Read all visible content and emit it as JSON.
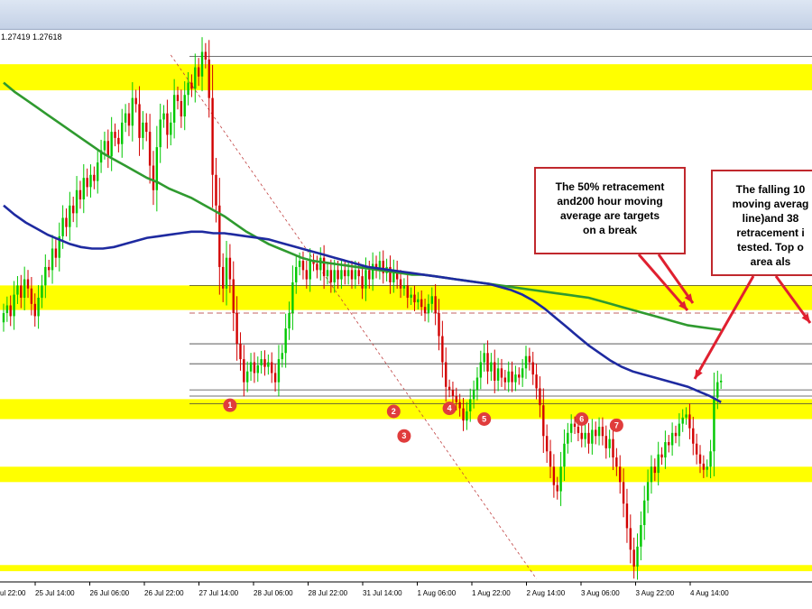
{
  "window": {
    "ohlc_text": "1.27419 1.27618"
  },
  "colors": {
    "background": "#ffffff",
    "zone": "#ffff00",
    "bull_candle": "#00c800",
    "bear_candle": "#d20000",
    "ma_100": "#1e2aa0",
    "ma_200": "#2f9a2f",
    "marker": "#e03c3c",
    "callout_border": "#c0282d",
    "arrow": "#e02030"
  },
  "chart_data": {
    "type": "candlestick",
    "x_tick_labels": [
      "25 Jul 14:00",
      "26 Jul 06:00",
      "26 Jul 22:00",
      "27 Jul 14:00",
      "28 Jul 06:00",
      "28 Jul 22:00",
      "31 Jul 14:00",
      "1 Aug 06:00",
      "1 Aug 22:00",
      "2 Aug 14:00",
      "3 Aug 06:00",
      "3 Aug 22:00",
      "4 Aug 14:00"
    ],
    "x_tick_partial": "ul 22:00",
    "ylim": [
      1.2615,
      1.2975
    ],
    "closes": [
      1.279,
      1.2795,
      1.2788,
      1.2802,
      1.2808,
      1.28,
      1.2812,
      1.2806,
      1.2796,
      1.2788,
      1.28,
      1.2808,
      1.282,
      1.2818,
      1.2832,
      1.2826,
      1.284,
      1.2852,
      1.2846,
      1.286,
      1.2855,
      1.287,
      1.2864,
      1.2878,
      1.2872,
      1.288,
      1.2876,
      1.2888,
      1.2896,
      1.2902,
      1.2892,
      1.2908,
      1.2904,
      1.29,
      1.2914,
      1.292,
      1.2912,
      1.293,
      1.2926,
      1.2904,
      1.2914,
      1.2908,
      1.2886,
      1.287,
      1.2898,
      1.2916,
      1.292,
      1.2906,
      1.2914,
      1.2932,
      1.2928,
      1.2918,
      1.2932,
      1.294,
      1.2936,
      1.295,
      1.2944,
      1.296,
      1.2955,
      1.293,
      1.288,
      1.286,
      1.282,
      1.2806,
      1.2826,
      1.2812,
      1.279,
      1.277,
      1.276,
      1.2745,
      1.2752,
      1.2758,
      1.2751,
      1.2756,
      1.276,
      1.2755,
      1.2758,
      1.2751,
      1.2745,
      1.276,
      1.2764,
      1.278,
      1.279,
      1.281,
      1.282,
      1.2824,
      1.2818,
      1.2812,
      1.2824,
      1.2822,
      1.2818,
      1.2826,
      1.2814,
      1.2818,
      1.281,
      1.2818,
      1.2812,
      1.2818,
      1.2814,
      1.2818,
      1.2812,
      1.2818,
      1.2814,
      1.2806,
      1.2818,
      1.2812,
      1.2822,
      1.2818,
      1.2824,
      1.2816,
      1.282,
      1.281,
      1.2818,
      1.2812,
      1.2806,
      1.2808,
      1.28,
      1.2802,
      1.2797,
      1.2799,
      1.2794,
      1.279,
      1.2796,
      1.2801,
      1.279,
      1.2775,
      1.2758,
      1.2742,
      1.274,
      1.2736,
      1.2732,
      1.2728,
      1.272,
      1.2726,
      1.2734,
      1.274,
      1.2748,
      1.2758,
      1.2764,
      1.2752,
      1.2758,
      1.2746,
      1.2754,
      1.2748,
      1.2745,
      1.2752,
      1.2745,
      1.275,
      1.2748,
      1.2754,
      1.2762,
      1.2758,
      1.275,
      1.2741,
      1.273,
      1.271,
      1.27,
      1.269,
      1.2678,
      1.2674,
      1.269,
      1.2705,
      1.2712,
      1.2718,
      1.2716,
      1.2712,
      1.2708,
      1.2712,
      1.2705,
      1.2714,
      1.271,
      1.2716,
      1.271,
      1.2702,
      1.2708,
      1.2696,
      1.269,
      1.268,
      1.2666,
      1.265,
      1.2636,
      1.2625,
      1.2638,
      1.2652,
      1.2668,
      1.268,
      1.269,
      1.2686,
      1.2698,
      1.2696,
      1.2706,
      1.2704,
      1.2712,
      1.271,
      1.2718,
      1.2722,
      1.2724,
      1.2715,
      1.2705,
      1.2698,
      1.2692,
      1.2688,
      1.269,
      1.27,
      1.2735,
      1.2745,
      1.2746
    ],
    "ma_100": [
      1.286,
      1.2854,
      1.2849,
      1.2845,
      1.2841,
      1.2838,
      1.2835,
      1.2833,
      1.2832,
      1.2832,
      1.2833,
      1.2835,
      1.2837,
      1.2839,
      1.284,
      1.2841,
      1.2842,
      1.2843,
      1.2843,
      1.2842,
      1.2842,
      1.2841,
      1.284,
      1.2839,
      1.2838,
      1.2836,
      1.2834,
      1.2832,
      1.283,
      1.2828,
      1.2826,
      1.2824,
      1.2822,
      1.282,
      1.2819,
      1.2818,
      1.2817,
      1.2816,
      1.2815,
      1.2814,
      1.2813,
      1.2812,
      1.2811,
      1.281,
      1.2809,
      1.2807,
      1.2805,
      1.2802,
      1.2798,
      1.2793,
      1.2787,
      1.2781,
      1.2775,
      1.2769,
      1.2764,
      1.2759,
      1.2755,
      1.2752,
      1.275,
      1.2748,
      1.2746,
      1.2744,
      1.2742,
      1.2739,
      1.2736,
      1.2732
    ],
    "ma_200": [
      1.294,
      1.2934,
      1.2929,
      1.2924,
      1.2919,
      1.2914,
      1.2909,
      1.2904,
      1.2899,
      1.2894,
      1.289,
      1.2886,
      1.2882,
      1.2878,
      1.2875,
      1.2871,
      1.2868,
      1.2865,
      1.2861,
      1.2857,
      1.2853,
      1.2848,
      1.2843,
      1.2839,
      1.2835,
      1.2832,
      1.2829,
      1.2826,
      1.2824,
      1.2823,
      1.2822,
      1.2821,
      1.282,
      1.2819,
      1.2818,
      1.2817,
      1.2816,
      1.2815,
      1.2815,
      1.2814,
      1.2813,
      1.2812,
      1.2811,
      1.281,
      1.2809,
      1.2808,
      1.2807,
      1.2806,
      1.2805,
      1.2804,
      1.2803,
      1.2802,
      1.2801,
      1.28,
      1.2798,
      1.2796,
      1.2794,
      1.2792,
      1.279,
      1.2788,
      1.2786,
      1.2784,
      1.2782,
      1.2781,
      1.278,
      1.2779
    ],
    "zones": [
      [
        1.2935,
        1.2952
      ],
      [
        1.2792,
        1.2808
      ],
      [
        1.2721,
        1.2734
      ],
      [
        1.268,
        1.269
      ],
      [
        1.2622,
        1.2626
      ]
    ],
    "horizontal_levels": [
      1.2957,
      1.2808,
      1.279,
      1.277,
      1.2757,
      1.274,
      1.2736,
      1.2731,
      1.2615
    ],
    "markers": [
      {
        "label": "1",
        "x": 65,
        "y": 1.273
      },
      {
        "label": "2",
        "x": 112,
        "y": 1.2726
      },
      {
        "label": "3",
        "x": 115,
        "y": 1.271
      },
      {
        "label": "4",
        "x": 128,
        "y": 1.2728
      },
      {
        "label": "5",
        "x": 138,
        "y": 1.2721
      },
      {
        "label": "6",
        "x": 166,
        "y": 1.2721
      },
      {
        "label": "7",
        "x": 176,
        "y": 1.2717
      }
    ],
    "trendline": {
      "from": [
        48,
        1.2958
      ],
      "to": [
        153,
        1.2617
      ]
    },
    "annotations": [
      "The 50% retracement and200 hour moving average  are targets on a break",
      "The falling 10 moving averag line)and 38 retracement i tested. Top o area als"
    ]
  },
  "callouts": {
    "one": [
      "The 50% retracement",
      "and200 hour moving",
      "average  are targets",
      "on a break"
    ],
    "two": [
      "The falling 10",
      "moving averag",
      "line)and 38",
      "retracement i",
      "tested. Top o",
      "area als"
    ]
  }
}
